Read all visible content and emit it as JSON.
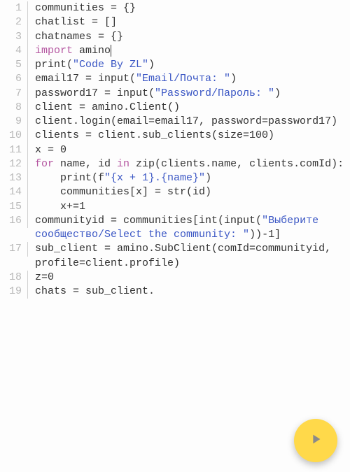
{
  "colors": {
    "keyword": "#b455a0",
    "string": "#3a56c4",
    "gutter": "#b8b8b8",
    "fab": "#ffd94a"
  },
  "lines": [
    {
      "num": "1",
      "segs": [
        {
          "t": "id",
          "v": "communities = {}"
        }
      ]
    },
    {
      "num": "2",
      "segs": [
        {
          "t": "id",
          "v": "chatlist = []"
        }
      ]
    },
    {
      "num": "3",
      "segs": [
        {
          "t": "id",
          "v": "chatnames = {}"
        }
      ]
    },
    {
      "num": "4",
      "segs": [
        {
          "t": "kw",
          "v": "import"
        },
        {
          "t": "id",
          "v": " amino"
        },
        {
          "t": "cursor",
          "v": ""
        }
      ]
    },
    {
      "num": "5",
      "segs": [
        {
          "t": "id",
          "v": "print("
        },
        {
          "t": "str",
          "v": "\"Code By ZL\""
        },
        {
          "t": "id",
          "v": ")"
        }
      ]
    },
    {
      "num": "6",
      "segs": [
        {
          "t": "id",
          "v": "email17 = input("
        },
        {
          "t": "str",
          "v": "\"Email/Почта: \""
        },
        {
          "t": "id",
          "v": ")"
        }
      ]
    },
    {
      "num": "7",
      "segs": [
        {
          "t": "id",
          "v": "password17 = input("
        },
        {
          "t": "str",
          "v": "\"Password/Пароль: \""
        },
        {
          "t": "id",
          "v": ")"
        }
      ]
    },
    {
      "num": "8",
      "segs": [
        {
          "t": "id",
          "v": "client = amino.Client()"
        }
      ]
    },
    {
      "num": "9",
      "segs": [
        {
          "t": "id",
          "v": "client.login(email=email17, password=password17)"
        }
      ]
    },
    {
      "num": "10",
      "segs": [
        {
          "t": "id",
          "v": "clients = client.sub_clients(size=100)"
        }
      ]
    },
    {
      "num": "11",
      "segs": [
        {
          "t": "id",
          "v": "x = 0"
        }
      ]
    },
    {
      "num": "12",
      "segs": [
        {
          "t": "kw",
          "v": "for"
        },
        {
          "t": "id",
          "v": " name, id "
        },
        {
          "t": "kw",
          "v": "in"
        },
        {
          "t": "id",
          "v": " zip(clients.name, clients.comId):"
        }
      ]
    },
    {
      "num": "13",
      "segs": [
        {
          "t": "id",
          "v": "    print(f"
        },
        {
          "t": "str",
          "v": "\"{x + 1}.{name}\""
        },
        {
          "t": "id",
          "v": ")"
        }
      ]
    },
    {
      "num": "14",
      "segs": [
        {
          "t": "id",
          "v": "    communities[x] = str(id)"
        }
      ]
    },
    {
      "num": "15",
      "segs": [
        {
          "t": "id",
          "v": "    x+=1"
        }
      ]
    },
    {
      "num": "16",
      "segs": [
        {
          "t": "id",
          "v": "communityid = communities[int(input("
        },
        {
          "t": "str",
          "v": "\"Выберите сообщество/Select the community: \""
        },
        {
          "t": "id",
          "v": "))-1]"
        }
      ]
    },
    {
      "num": "17",
      "segs": [
        {
          "t": "id",
          "v": "sub_client = amino.SubClient(comId=communityid, profile=client.profile)"
        }
      ]
    },
    {
      "num": "18",
      "segs": [
        {
          "t": "id",
          "v": "z=0"
        }
      ]
    },
    {
      "num": "19",
      "segs": [
        {
          "t": "id",
          "v": "chats = sub_client."
        }
      ]
    }
  ],
  "fab": {
    "label": "run"
  }
}
